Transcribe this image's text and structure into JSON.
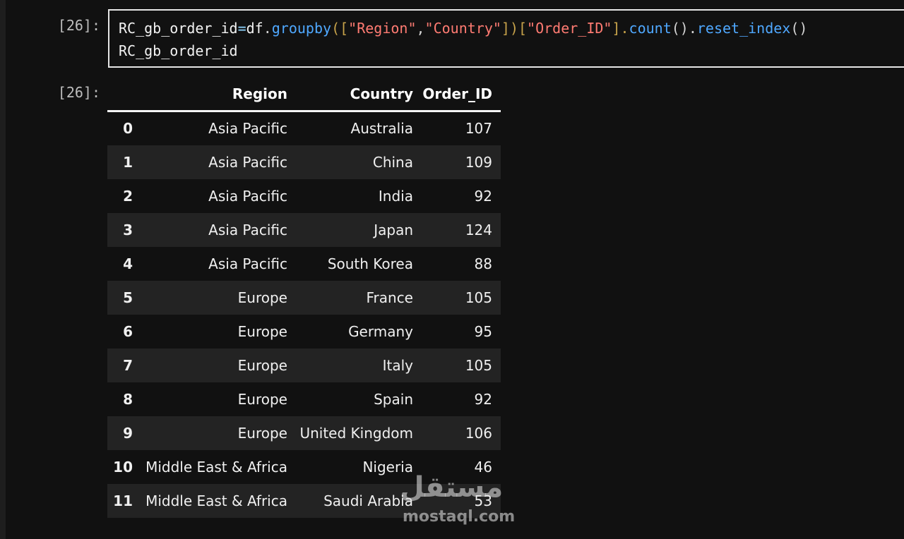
{
  "cell": {
    "input_prompt": "[26]:",
    "output_prompt": "[26]:",
    "code": {
      "line1": {
        "var": "RC_gb_order_id",
        "eq": "=",
        "df": "df",
        "dot1": ".",
        "groupby": "groupby",
        "open1": "([",
        "str1": "\"Region\"",
        "comma": ",",
        "str2": "\"Country\"",
        "close1": "])[",
        "str3": "\"Order_ID\"",
        "close2": "].",
        "count": "count",
        "paren1": "().",
        "reset": "reset_index",
        "paren2": "()"
      },
      "line2": "RC_gb_order_id"
    }
  },
  "table": {
    "columns": [
      "",
      "Region",
      "Country",
      "Order_ID"
    ],
    "rows": [
      [
        "0",
        "Asia Pacific",
        "Australia",
        "107"
      ],
      [
        "1",
        "Asia Pacific",
        "China",
        "109"
      ],
      [
        "2",
        "Asia Pacific",
        "India",
        "92"
      ],
      [
        "3",
        "Asia Pacific",
        "Japan",
        "124"
      ],
      [
        "4",
        "Asia Pacific",
        "South Korea",
        "88"
      ],
      [
        "5",
        "Europe",
        "France",
        "105"
      ],
      [
        "6",
        "Europe",
        "Germany",
        "95"
      ],
      [
        "7",
        "Europe",
        "Italy",
        "105"
      ],
      [
        "8",
        "Europe",
        "Spain",
        "92"
      ],
      [
        "9",
        "Europe",
        "United Kingdom",
        "106"
      ],
      [
        "10",
        "Middle East & Africa",
        "Nigeria",
        "46"
      ],
      [
        "11",
        "Middle East & Africa",
        "Saudi Arabia",
        "53"
      ]
    ]
  },
  "watermark": {
    "arabic": "مستقل",
    "latin": "mostaql.com"
  }
}
